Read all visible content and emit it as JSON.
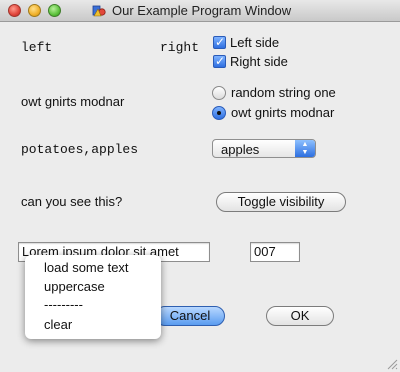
{
  "window": {
    "title": "Our Example Program Window",
    "icon": "app-icon"
  },
  "rows": {
    "row1": {
      "left_text": "left",
      "right_text": "right"
    },
    "row2": {
      "text": "owt gnirts modnar"
    },
    "row3": {
      "text": "potatoes,apples"
    },
    "row4": {
      "text": "can you see this?"
    }
  },
  "checkboxes": [
    {
      "label": "Left side",
      "checked": true
    },
    {
      "label": "Right side",
      "checked": true
    }
  ],
  "radios": [
    {
      "label": "random string one",
      "selected": false
    },
    {
      "label": "owt gnirts modnar",
      "selected": true
    }
  ],
  "select": {
    "value": "apples"
  },
  "toggle_button": {
    "label": "Toggle visibility"
  },
  "text_field": {
    "value": "Lorem ipsum dolor sit amet"
  },
  "number_field": {
    "value": "007"
  },
  "context_menu": {
    "items": [
      "load some text",
      "uppercase",
      "---------",
      "clear"
    ]
  },
  "buttons": {
    "cancel": "Cancel",
    "ok": "OK"
  },
  "colors": {
    "accent": "#2f6fe0",
    "window_bg": "#ececec"
  }
}
